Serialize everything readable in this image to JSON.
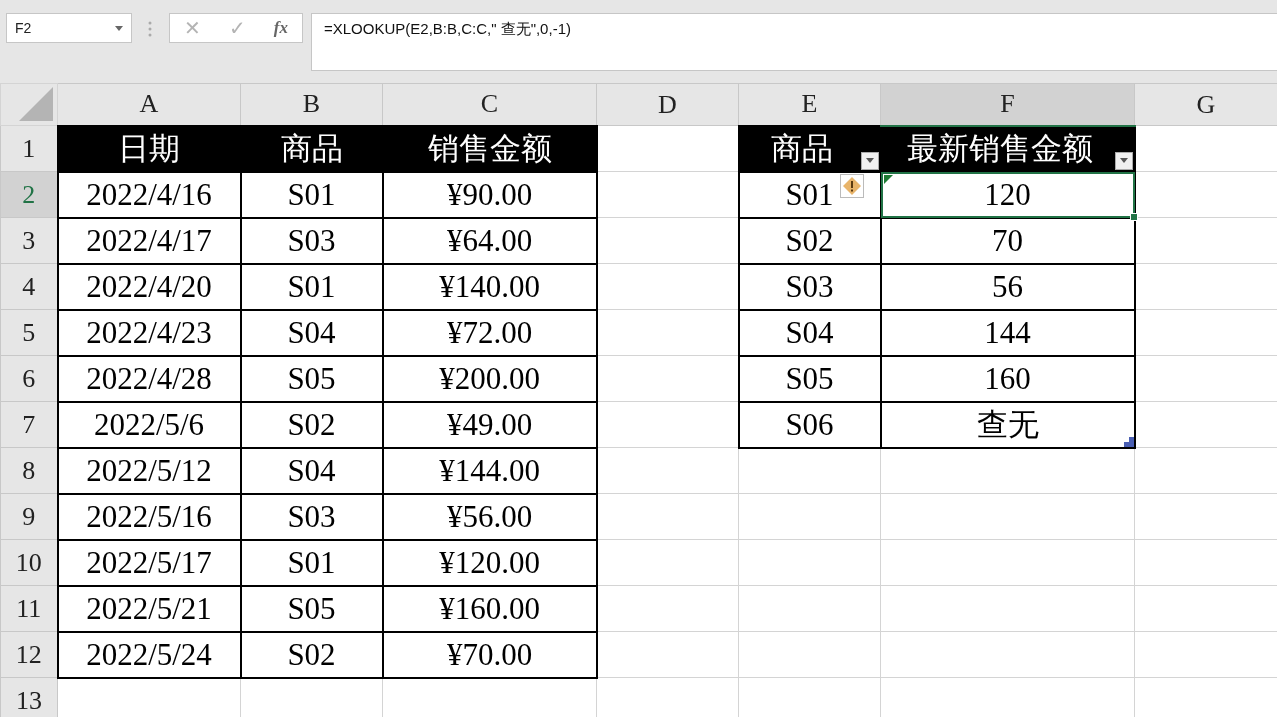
{
  "name_box": {
    "value": "F2"
  },
  "formula_bar": {
    "cancel": "✕",
    "enter": "✓",
    "function": "fx",
    "value": "=XLOOKUP(E2,B:B,C:C,\" 查无\",0,-1)"
  },
  "column_headers": [
    {
      "label": "A",
      "selected": false
    },
    {
      "label": "B",
      "selected": false
    },
    {
      "label": "C",
      "selected": false
    },
    {
      "label": "D",
      "selected": false
    },
    {
      "label": "E",
      "selected": false
    },
    {
      "label": "F",
      "selected": true
    },
    {
      "label": "G",
      "selected": false
    }
  ],
  "header_row": {
    "number": "1",
    "selected": false,
    "cells": {
      "A": {
        "text": "日期",
        "filter": false
      },
      "B": {
        "text": "商品",
        "filter": false
      },
      "C": {
        "text": "销售金额",
        "filter": false
      },
      "E": {
        "text": "商品",
        "filter": true
      },
      "F": {
        "text": "最新销售金额",
        "filter": true
      }
    }
  },
  "rows": [
    {
      "number": "2",
      "selected": true,
      "cells": {
        "A": "2022/4/16",
        "B": "S01",
        "C": "¥90.00",
        "E": "S01",
        "F": "120"
      }
    },
    {
      "number": "3",
      "selected": false,
      "cells": {
        "A": "2022/4/17",
        "B": "S03",
        "C": "¥64.00",
        "E": "S02",
        "F": "70"
      }
    },
    {
      "number": "4",
      "selected": false,
      "cells": {
        "A": "2022/4/20",
        "B": "S01",
        "C": "¥140.00",
        "E": "S03",
        "F": "56"
      }
    },
    {
      "number": "5",
      "selected": false,
      "cells": {
        "A": "2022/4/23",
        "B": "S04",
        "C": "¥72.00",
        "E": "S04",
        "F": "144"
      }
    },
    {
      "number": "6",
      "selected": false,
      "cells": {
        "A": "2022/4/28",
        "B": "S05",
        "C": "¥200.00",
        "E": "S05",
        "F": "160"
      }
    },
    {
      "number": "7",
      "selected": false,
      "cells": {
        "A": "2022/5/6",
        "B": "S02",
        "C": "¥49.00",
        "E": "S06",
        "F": "查无"
      }
    },
    {
      "number": "8",
      "selected": false,
      "cells": {
        "A": "2022/5/12",
        "B": "S04",
        "C": "¥144.00"
      }
    },
    {
      "number": "9",
      "selected": false,
      "cells": {
        "A": "2022/5/16",
        "B": "S03",
        "C": "¥56.00"
      }
    },
    {
      "number": "10",
      "selected": false,
      "cells": {
        "A": "2022/5/17",
        "B": "S01",
        "C": "¥120.00"
      }
    },
    {
      "number": "11",
      "selected": false,
      "cells": {
        "A": "2022/5/21",
        "B": "S05",
        "C": "¥160.00"
      }
    },
    {
      "number": "12",
      "selected": false,
      "cells": {
        "A": "2022/5/24",
        "B": "S02",
        "C": "¥70.00"
      }
    },
    {
      "number": "13",
      "selected": false,
      "cells": {}
    }
  ]
}
